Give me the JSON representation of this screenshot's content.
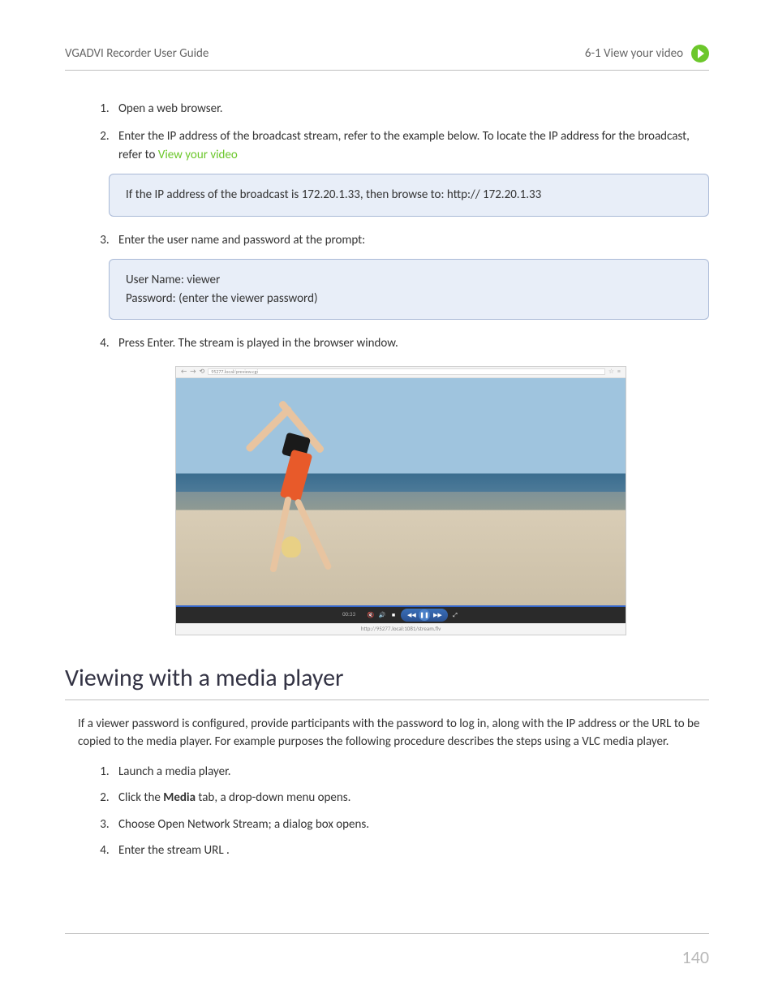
{
  "header": {
    "left": "VGADVI Recorder User Guide",
    "right_section": "6-1  View your video"
  },
  "steps_a": {
    "s1": "Open a web browser.",
    "s2_a": "Enter the IP address of the broadcast stream, refer to the example below. To locate the IP address for the broadcast, refer to  ",
    "s2_link": "View your video",
    "s3": "Enter the user name and password at the prompt:",
    "s4": "Press Enter. The stream is played in the browser window."
  },
  "note1": "If the IP address of the broadcast is 172.20.1.33, then browse to: http:// 172.20.1.33",
  "note2": {
    "l1": "User Name: viewer",
    "l2": "Password: (enter the viewer password)"
  },
  "screenshot": {
    "addr": "95277.local/preview.cgi",
    "time": "00:33",
    "footer_url": "http://95277.local:1081/stream.flv"
  },
  "section2": {
    "title": "Viewing with a media player",
    "intro": "If a viewer password is configured, provide participants with the password to log in, along with the IP address or the URL to be copied to the media player. For example purposes the following procedure describes the steps using a VLC media player.",
    "s1": "Launch a media player.",
    "s2_a": "Click the ",
    "s2_b": "Media",
    "s2_c": " tab, a drop-down menu opens.",
    "s3": "Choose Open Network Stream; a dialog box opens.",
    "s4": "Enter the stream URL ."
  },
  "page_number": "140"
}
